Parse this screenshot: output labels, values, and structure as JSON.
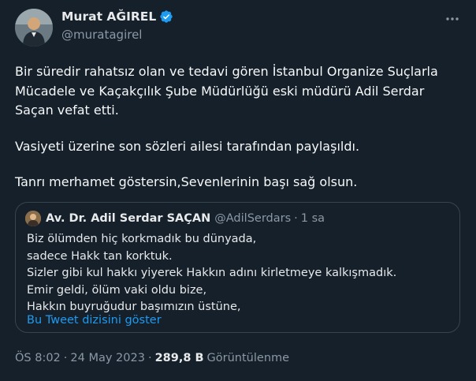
{
  "author": {
    "name": "Murat AĞIREL",
    "handle": "@muratagirel",
    "verified": true,
    "verified_color": "#1d9bf0"
  },
  "tweet": {
    "paragraphs": [
      "Bir süredir rahatsız olan ve tedavi gören İstanbul Organize Suçlarla Mücadele ve Kaçakçılık Şube Müdürlüğü eski müdürü Adil Serdar Saçan vefat etti.",
      "Vasiyeti üzerine son sözleri ailesi tarafından paylaşıldı.",
      "Tanrı merhamet göstersin,Sevenlerinin başı sağ olsun."
    ]
  },
  "quote": {
    "name": "Av. Dr. Adil Serdar SAÇAN",
    "handle": "@AdilSerdars",
    "dot": "·",
    "time": "1 sa",
    "lines": [
      "Biz ölümden hiç korkmadık bu dünyada,",
      "sadece Hakk tan korktuk.",
      "Sizler gibi kul hakkı yiyerek Hakkın adını kirletmeye kalkışmadık.",
      "Emir geldi, ölüm vaki oldu bize,",
      "Hakkın buyruğudur başımızın üstüne,"
    ],
    "show_thread": "Bu Tweet dizisini göster"
  },
  "meta": {
    "time": "ÖS 8:02",
    "dot": "·",
    "date": "24 May 2023",
    "views_count": "289,8 B",
    "views_label": "Görüntülenme"
  },
  "icons": {
    "more": "more-icon",
    "verified": "verified-badge-icon"
  },
  "colors": {
    "background": "#15202b",
    "link": "#1d9bf0",
    "secondary_text": "#8b98a5",
    "border": "#38444d"
  }
}
